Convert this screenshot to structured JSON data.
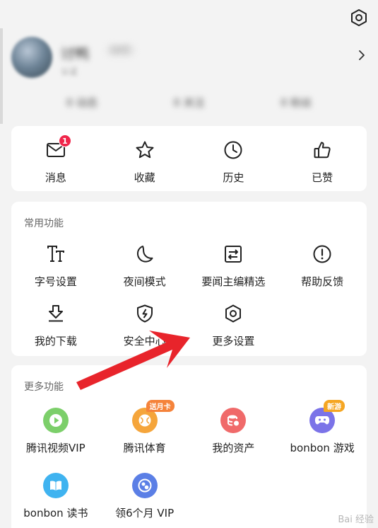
{
  "profile": {
    "username": "讨鸭",
    "tag": "LV2",
    "subtitle": "认证",
    "stats": [
      "0 动态",
      "0 关注",
      "0 粉丝"
    ]
  },
  "quick": {
    "messages": {
      "label": "消息",
      "badge": "1"
    },
    "favorites": {
      "label": "收藏"
    },
    "history": {
      "label": "历史"
    },
    "liked": {
      "label": "已赞"
    }
  },
  "common": {
    "title": "常用功能",
    "items": [
      {
        "label": "字号设置",
        "icon": "font-size-icon"
      },
      {
        "label": "夜间模式",
        "icon": "moon-icon"
      },
      {
        "label": "要闻主编精选",
        "icon": "swap-icon"
      },
      {
        "label": "帮助反馈",
        "icon": "help-icon"
      },
      {
        "label": "我的下载",
        "icon": "download-icon"
      },
      {
        "label": "安全中心",
        "icon": "shield-icon"
      },
      {
        "label": "更多设置",
        "icon": "settings-icon"
      }
    ]
  },
  "more": {
    "title": "更多功能",
    "items": [
      {
        "label": "腾讯视频VIP",
        "icon": "video-play-icon",
        "color": "#7ccf6a"
      },
      {
        "label": "腾讯体育",
        "icon": "sports-ball-icon",
        "color": "#f5a53b",
        "badge": "送月卡"
      },
      {
        "label": "我的资产",
        "icon": "assets-icon",
        "color": "#f06a6a"
      },
      {
        "label": "bonbon 游戏",
        "icon": "gamepad-icon",
        "color": "#7b73e8",
        "badge": "新游"
      },
      {
        "label": "bonbon 读书",
        "icon": "book-icon",
        "color": "#3fb3f0"
      },
      {
        "label": "领6个月 VIP",
        "icon": "vip-icon",
        "color": "#5b7fe6"
      }
    ]
  },
  "colors": {
    "badge_red": "#f0254a",
    "arrow_red": "#e8242b",
    "sports_badge": "#f5833b",
    "game_badge": "#f5a623"
  },
  "watermark": "Bai 经验"
}
